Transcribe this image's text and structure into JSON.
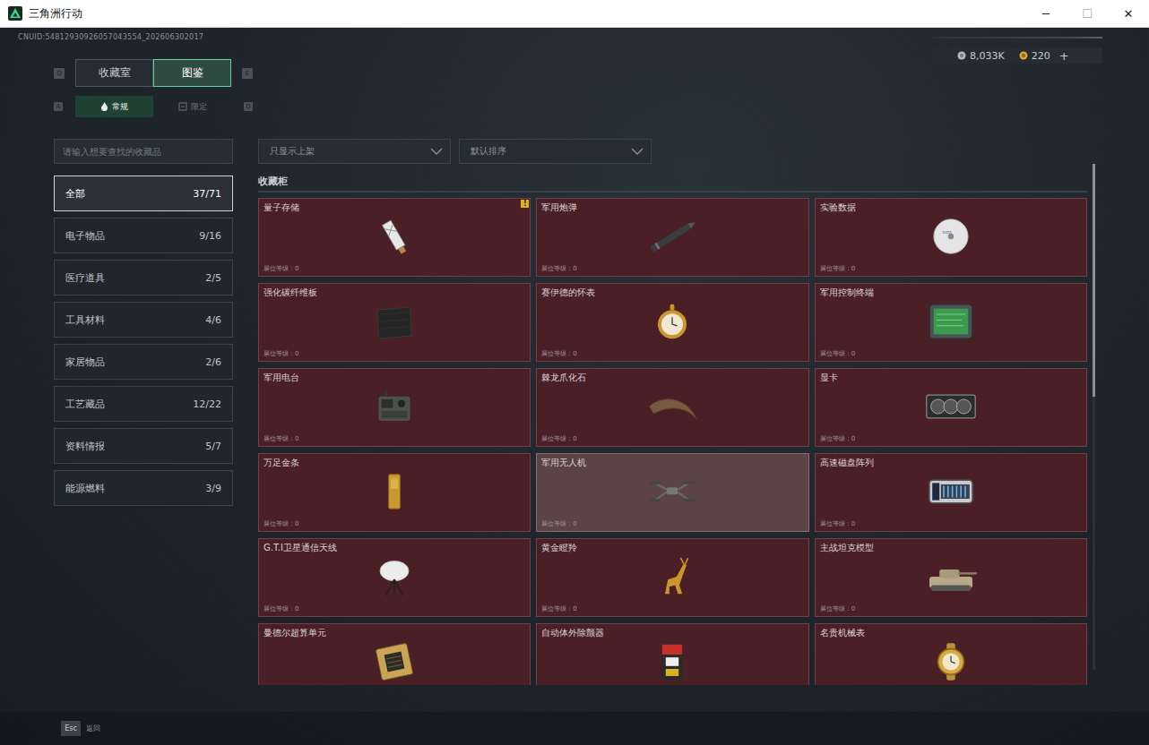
{
  "window": {
    "title": "三角洲行动",
    "controls": [
      "─",
      "☐",
      "✕"
    ]
  },
  "uid": "CNUID:54812930926057043554_202606302017",
  "tabs": {
    "prev_key": "Q",
    "next_key": "E",
    "items": [
      {
        "label": "收藏室",
        "selected": false
      },
      {
        "label": "图鉴",
        "selected": true
      }
    ]
  },
  "subtabs": {
    "prev_key": "A",
    "next_key": "D",
    "items": [
      {
        "label": "常规",
        "selected": true
      },
      {
        "label": "限定",
        "selected": false
      }
    ]
  },
  "currency": [
    {
      "amount": "8,033K",
      "add": ""
    },
    {
      "amount": "220",
      "add": "+"
    }
  ],
  "search": {
    "placeholder": "请输入想要查找的收藏品"
  },
  "filters": [
    {
      "label": "只显示上架"
    },
    {
      "label": "默认排序"
    }
  ],
  "categories": [
    {
      "name": "全部",
      "count": "37/71",
      "selected": true
    },
    {
      "name": "电子物品",
      "count": "9/16",
      "selected": false
    },
    {
      "name": "医疗道具",
      "count": "2/5",
      "selected": false
    },
    {
      "name": "工具材料",
      "count": "4/6",
      "selected": false
    },
    {
      "name": "家居物品",
      "count": "2/6",
      "selected": false
    },
    {
      "name": "工艺藏品",
      "count": "12/22",
      "selected": false
    },
    {
      "name": "资料情报",
      "count": "5/7",
      "selected": false
    },
    {
      "name": "能源燃料",
      "count": "3/9",
      "selected": false
    }
  ],
  "section": {
    "title": "收藏柜"
  },
  "items": [
    {
      "name": "量子存储",
      "level_text": "展位等级：0",
      "selected": false,
      "badge": "!"
    },
    {
      "name": "军用炮弹",
      "level_text": "展位等级：0",
      "selected": false,
      "badge": ""
    },
    {
      "name": "实验数据",
      "level_text": "展位等级：0",
      "selected": false,
      "badge": ""
    },
    {
      "name": "强化碳纤维板",
      "level_text": "展位等级：0",
      "selected": false,
      "badge": ""
    },
    {
      "name": "赛伊德的怀表",
      "level_text": "展位等级：0",
      "selected": false,
      "badge": ""
    },
    {
      "name": "军用控制终端",
      "level_text": "展位等级：0",
      "selected": false,
      "badge": ""
    },
    {
      "name": "军用电台",
      "level_text": "展位等级：0",
      "selected": false,
      "badge": ""
    },
    {
      "name": "棘龙爪化石",
      "level_text": "展位等级：0",
      "selected": false,
      "badge": ""
    },
    {
      "name": "显卡",
      "level_text": "展位等级：0",
      "selected": false,
      "badge": ""
    },
    {
      "name": "万足金条",
      "level_text": "展位等级：0",
      "selected": false,
      "badge": ""
    },
    {
      "name": "军用无人机",
      "level_text": "展位等级：0",
      "selected": true,
      "badge": ""
    },
    {
      "name": "高速磁盘阵列",
      "level_text": "展位等级：0",
      "selected": false,
      "badge": ""
    },
    {
      "name": "G.T.I卫星通信天线",
      "level_text": "展位等级：0",
      "selected": false,
      "badge": ""
    },
    {
      "name": "黄金瞪羚",
      "level_text": "展位等级：0",
      "selected": false,
      "badge": ""
    },
    {
      "name": "主战坦克模型",
      "level_text": "展位等级：0",
      "selected": false,
      "badge": ""
    },
    {
      "name": "曼德尔超算单元",
      "level_text": "",
      "selected": false,
      "badge": ""
    },
    {
      "name": "自动体外除颤器",
      "level_text": "",
      "selected": false,
      "badge": ""
    },
    {
      "name": "名贵机械表",
      "level_text": "",
      "selected": false,
      "badge": ""
    }
  ],
  "footer": {
    "key": "Esc",
    "label": "返回"
  }
}
